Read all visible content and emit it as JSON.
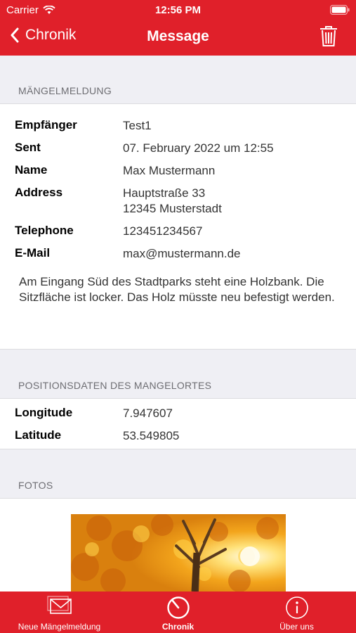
{
  "status_bar": {
    "carrier": "Carrier",
    "time": "12:56 PM"
  },
  "nav": {
    "back_label": "Chronik",
    "title": "Message"
  },
  "sections": {
    "report": {
      "header": "MÄNGELMELDUNG",
      "rows": [
        {
          "label": "Empfänger",
          "value": "Test1"
        },
        {
          "label": "Sent",
          "value": "07. February 2022 um 12:55"
        },
        {
          "label": "Name",
          "value": "Max Mustermann"
        },
        {
          "label": "Address",
          "value": "Hauptstraße 33\n12345 Musterstadt"
        },
        {
          "label": "Telephone",
          "value": "123451234567"
        },
        {
          "label": "E-Mail",
          "value": "max@mustermann.de"
        }
      ],
      "description": "Am Eingang Süd des Stadtparks steht eine Holzbank. Die Sitzfläche ist locker. Das Holz müsste neu befestigt werden."
    },
    "position": {
      "header": "POSITIONSDATEN DES MANGELORTES",
      "rows": [
        {
          "label": "Longitude",
          "value": "7.947607"
        },
        {
          "label": "Latitude",
          "value": "53.549805"
        }
      ]
    },
    "photos": {
      "header": "FOTOS"
    }
  },
  "tabbar": {
    "tabs": [
      {
        "label": "Neue Mängelmeldung",
        "icon": "mail-icon"
      },
      {
        "label": "Chronik",
        "icon": "clock-icon",
        "active": true
      },
      {
        "label": "Über uns",
        "icon": "info-icon"
      }
    ]
  },
  "colors": {
    "accent": "#e0202a",
    "background": "#efeff4"
  }
}
